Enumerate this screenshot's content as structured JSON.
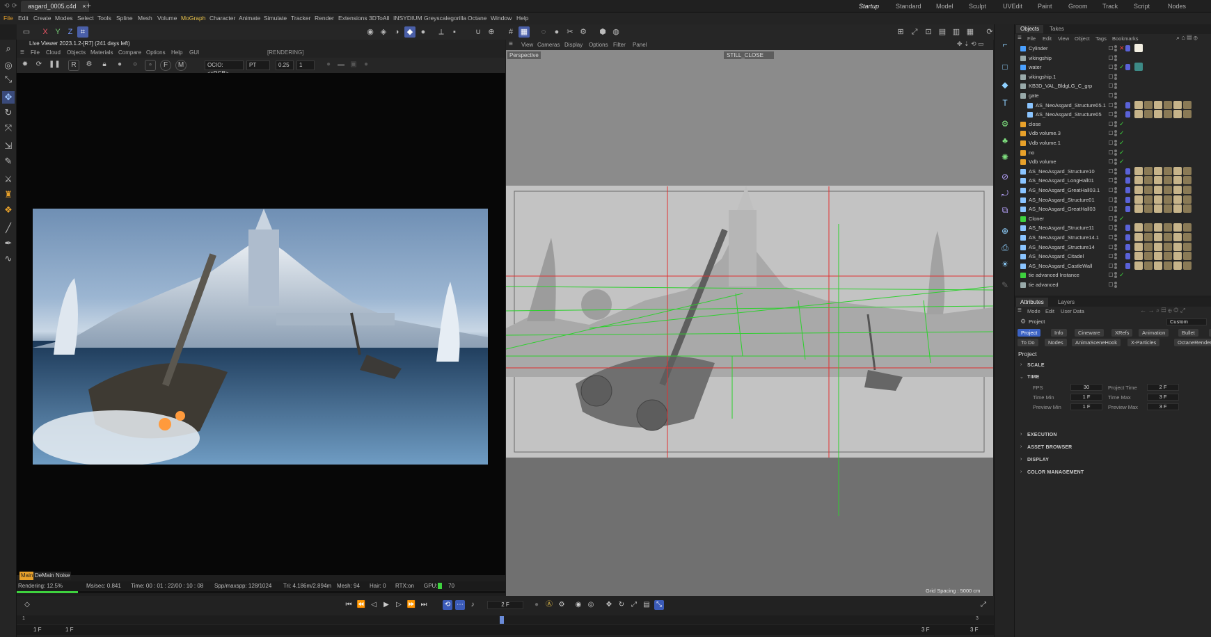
{
  "document_tab": "asgard_0005.c4d",
  "layouts": [
    "Startup",
    "Standard",
    "Model",
    "Sculpt",
    "UVEdit",
    "Paint",
    "Groom",
    "Track",
    "Script",
    "Nodes"
  ],
  "active_layout": "Startup",
  "menus": [
    "File",
    "Edit",
    "Create",
    "Modes",
    "Select",
    "Tools",
    "Spline",
    "Mesh",
    "Volume",
    "MoGraph",
    "Character",
    "Animate",
    "Simulate",
    "Tracker",
    "Render",
    "Extensions",
    "3DToAll",
    "INSYDIUM",
    "Greyscalegorilla",
    "Octane",
    "Window",
    "Help"
  ],
  "axes": [
    "X",
    "Y",
    "Z"
  ],
  "live_viewer": {
    "title": "Live Viewer 2023.1.2-[R7] (241 days left)",
    "menus": [
      "File",
      "Cloud",
      "Objects",
      "Materials",
      "Compare",
      "Options",
      "Help",
      "GUI"
    ],
    "state": "[RENDERING]",
    "color_space": "OCIO:<sRGB>",
    "kernel": "PT",
    "value_a": "0.25",
    "value_b": "1",
    "tags": [
      "Main",
      "DeMain",
      "Noise"
    ],
    "status": {
      "rendering": "Rendering: 12.5%",
      "ms_sec": "Ms/sec: 0.841",
      "time": "Time: 00 : 01 : 22/00 : 10 : 08",
      "spp": "Spp/maxspp: 128/1024",
      "tri": "Tri: 4.186m/2.894m",
      "mesh": "Mesh: 94",
      "hair": "Hair: 0",
      "rtx": "RTX:on",
      "gpu_label": "GPU:",
      "gpu_value": "70"
    },
    "progress": 0.125
  },
  "viewport": {
    "menus": [
      "View",
      "Cameras",
      "Display",
      "Options",
      "Filter",
      "Panel"
    ],
    "label": "Perspective",
    "camera": "STILL_CLOSE",
    "grid_spacing": "Grid Spacing : 5000 cm"
  },
  "objects_panel": {
    "tabs": [
      "Objects",
      "Takes"
    ],
    "menus": [
      "File",
      "Edit",
      "View",
      "Object",
      "Tags",
      "Bookmarks"
    ],
    "rows": [
      {
        "name": "Cylinder",
        "indent": 0,
        "mark": "x",
        "icon_color": "#4aa0ff"
      },
      {
        "name": "vikingship",
        "indent": 0,
        "mark": "",
        "icon_color": "#9aa"
      },
      {
        "name": "water",
        "indent": 0,
        "mark": "check",
        "icon_color": "#4aa0ff"
      },
      {
        "name": "vikingship.1",
        "indent": 0,
        "mark": "",
        "icon_color": "#9aa"
      },
      {
        "name": "KB3D_VAL_BldgLG_C_grp",
        "indent": 0,
        "mark": "",
        "icon_color": "#9aa"
      },
      {
        "name": "gate",
        "indent": 0,
        "mark": "",
        "icon_color": "#9aa"
      },
      {
        "name": "AS_NeoAsgard_Structure05.1",
        "indent": 1,
        "mark": "",
        "icon_color": "#8ac4ff"
      },
      {
        "name": "AS_NeoAsgard_Structure05",
        "indent": 1,
        "mark": "",
        "icon_color": "#8ac4ff"
      },
      {
        "name": "close",
        "indent": 0,
        "mark": "check",
        "icon_color": "#e8a12a"
      },
      {
        "name": "Vdb volume.3",
        "indent": 0,
        "mark": "check",
        "icon_color": "#e8a12a"
      },
      {
        "name": "Vdb volume.1",
        "indent": 0,
        "mark": "check",
        "icon_color": "#e8a12a"
      },
      {
        "name": "no",
        "indent": 0,
        "mark": "check",
        "icon_color": "#e8a12a"
      },
      {
        "name": "Vdb volume",
        "indent": 0,
        "mark": "check",
        "icon_color": "#e8a12a"
      },
      {
        "name": "AS_NeoAsgard_Structure10",
        "indent": 0,
        "mark": "",
        "icon_color": "#8ac4ff"
      },
      {
        "name": "AS_NeoAsgard_LongHall01",
        "indent": 0,
        "mark": "",
        "icon_color": "#8ac4ff"
      },
      {
        "name": "AS_NeoAsgard_GreatHall03.1",
        "indent": 0,
        "mark": "",
        "icon_color": "#8ac4ff"
      },
      {
        "name": "AS_NeoAsgard_Structure01",
        "indent": 0,
        "mark": "",
        "icon_color": "#8ac4ff"
      },
      {
        "name": "AS_NeoAsgard_GreatHall03",
        "indent": 0,
        "mark": "",
        "icon_color": "#8ac4ff"
      },
      {
        "name": "Cloner",
        "indent": 0,
        "mark": "check",
        "icon_color": "#3ed23e"
      },
      {
        "name": "AS_NeoAsgard_Structure11",
        "indent": 0,
        "mark": "",
        "icon_color": "#8ac4ff"
      },
      {
        "name": "AS_NeoAsgard_Structure14.1",
        "indent": 0,
        "mark": "",
        "icon_color": "#8ac4ff"
      },
      {
        "name": "AS_NeoAsgard_Structure14",
        "indent": 0,
        "mark": "",
        "icon_color": "#8ac4ff"
      },
      {
        "name": "AS_NeoAsgard_Citadel",
        "indent": 0,
        "mark": "",
        "icon_color": "#8ac4ff"
      },
      {
        "name": "AS_NeoAsgard_CastleWall",
        "indent": 0,
        "mark": "",
        "icon_color": "#8ac4ff"
      },
      {
        "name": "tie advanced Instance",
        "indent": 0,
        "mark": "check",
        "icon_color": "#3ed23e"
      },
      {
        "name": "tie advanced",
        "indent": 0,
        "mark": "",
        "icon_color": "#9aa"
      }
    ]
  },
  "attributes_panel": {
    "tabs": [
      "Attributes",
      "Layers"
    ],
    "menus": [
      "Mode",
      "Edit",
      "User Data"
    ],
    "object": "Project",
    "preset": "Custom",
    "buttons_row1": [
      "Project",
      "Info",
      "Cineware",
      "XRefs",
      "Animation",
      "Bullet",
      "Simulation"
    ],
    "buttons_row2": [
      "To Do",
      "Nodes",
      "AnimaSceneHook",
      "X-Particles",
      "OctaneRender"
    ],
    "heading": "Project",
    "sections": [
      "SCALE",
      "TIME",
      "EXECUTION",
      "ASSET BROWSER",
      "DISPLAY",
      "COLOR MANAGEMENT"
    ],
    "time": {
      "fps_label": "FPS",
      "fps": "30",
      "project_time_label": "Project Time",
      "project_time": "2 F",
      "time_min_label": "Time Min",
      "time_min": "1 F",
      "time_max_label": "Time Max",
      "time_max": "3 F",
      "preview_min_label": "Preview Min",
      "preview_min": "1 F",
      "preview_max_label": "Preview Max",
      "preview_max": "3 F"
    }
  },
  "timeline": {
    "current_frame": "2 F",
    "ruler_start": "1",
    "ruler_end": "3",
    "start_a": "1 F",
    "start_b": "1 F",
    "end_a": "3 F",
    "end_b": "3 F"
  },
  "colors": {
    "accent": "#3b62c4",
    "check": "#3ed23e",
    "error": "#e84040",
    "warn": "#e8a12a"
  }
}
